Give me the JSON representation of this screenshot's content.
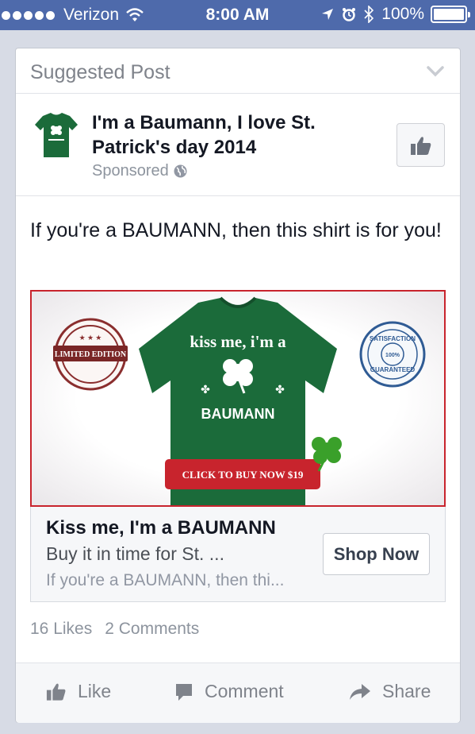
{
  "status_bar": {
    "carrier": "Verizon",
    "time": "8:00 AM",
    "battery": "100%"
  },
  "post": {
    "header_label": "Suggested Post",
    "page_name": "I'm a Baumann, I love St. Patrick's day 2014",
    "sponsored": "Sponsored",
    "message": "If you're a BAUMANN, then this shirt is for you!",
    "ad_image": {
      "badge_left": "LIMITED EDITION",
      "shirt_arc": "kiss me, i'm a",
      "shirt_name": "BAUMANN",
      "buy_button": "CLICK TO BUY NOW $19",
      "badge_right_top": "SATISFACTION",
      "badge_right_center": "100%",
      "badge_right_bottom": "GUARANTEED"
    },
    "link": {
      "title": "Kiss me, I'm a BAUMANN",
      "description": "Buy it in time for St. ...",
      "caption": "If you're a BAUMANN, then thi...",
      "cta": "Shop Now"
    },
    "counts": {
      "likes": "16 Likes",
      "comments": "2 Comments"
    },
    "actions": {
      "like": "Like",
      "comment": "Comment",
      "share": "Share"
    }
  },
  "colors": {
    "status_bar": "#4e6aab",
    "shirt_green": "#1b6b3a",
    "buy_red": "#c8242d"
  }
}
